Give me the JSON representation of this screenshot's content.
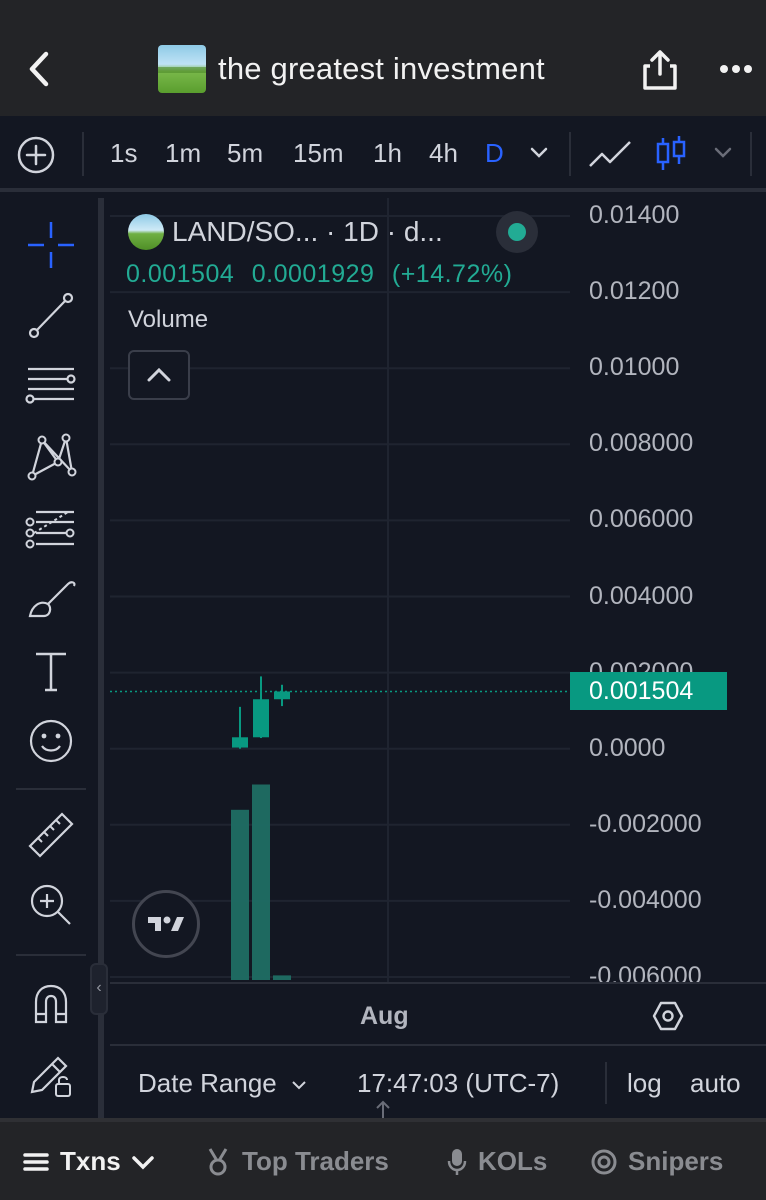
{
  "header": {
    "title": "the greatest investment",
    "back_icon": "chevron-left-icon",
    "share_icon": "share-icon",
    "more_icon": "more-horizontal-icon"
  },
  "toolbar": {
    "add_icon": "plus-circle-icon",
    "intervals": [
      {
        "label": "1s",
        "active": false
      },
      {
        "label": "1m",
        "active": false
      },
      {
        "label": "5m",
        "active": false
      },
      {
        "label": "15m",
        "active": false
      },
      {
        "label": "1h",
        "active": false
      },
      {
        "label": "4h",
        "active": false
      },
      {
        "label": "D",
        "active": true
      }
    ],
    "active_color": "#2962ff",
    "chart_type_icons": [
      "line-chart-icon",
      "candlestick-icon"
    ]
  },
  "drawing_tools": [
    "crosshair-icon",
    "trend-line-icon",
    "horizontal-lines-icon",
    "pattern-icon",
    "fib-retracement-icon",
    "brush-icon",
    "text-icon",
    "emoji-icon",
    "ruler-icon",
    "zoom-in-icon",
    "magnet-icon",
    "lock-drawings-icon"
  ],
  "legend": {
    "symbol": "LAND/SO... · 1D · d...",
    "last": "0.001504",
    "change": "0.0001929",
    "change_pct": "(+14.72%)",
    "volume_label": "Volume",
    "status_color": "#22ab94"
  },
  "price_axis": {
    "labels": [
      "0.01400",
      "0.01200",
      "0.01000",
      "0.008000",
      "0.006000",
      "0.004000",
      "0.002000",
      "0.0000",
      "-0.002000",
      "-0.004000",
      "-0.006000"
    ],
    "current_price": "0.001504",
    "current_price_color": "#089981"
  },
  "time_axis": {
    "labels": [
      "Aug"
    ]
  },
  "footer": {
    "date_range": "Date Range",
    "clock": "17:47:03 (UTC-7)",
    "log": "log",
    "auto": "auto"
  },
  "chart_data": {
    "type": "candlestick",
    "ylim": [
      -0.006,
      0.014
    ],
    "candles": [
      {
        "open": 3e-05,
        "high": 0.0011,
        "low": 0.0,
        "close": 0.0003
      },
      {
        "open": 0.0003,
        "high": 0.0019,
        "low": 0.00028,
        "close": 0.0013
      },
      {
        "open": 0.0013,
        "high": 0.00168,
        "low": 0.00112,
        "close": 0.001504
      }
    ],
    "volume_relative": [
      0.74,
      0.85,
      0.02
    ],
    "up_color": "#089981"
  },
  "bottom_tabs": [
    {
      "label": "Txns",
      "icon": "menu-icon",
      "active": true
    },
    {
      "label": "Top Traders",
      "icon": "medal-icon",
      "active": false
    },
    {
      "label": "KOLs",
      "icon": "microphone-icon",
      "active": false
    },
    {
      "label": "Snipers",
      "icon": "target-icon",
      "active": false
    }
  ]
}
